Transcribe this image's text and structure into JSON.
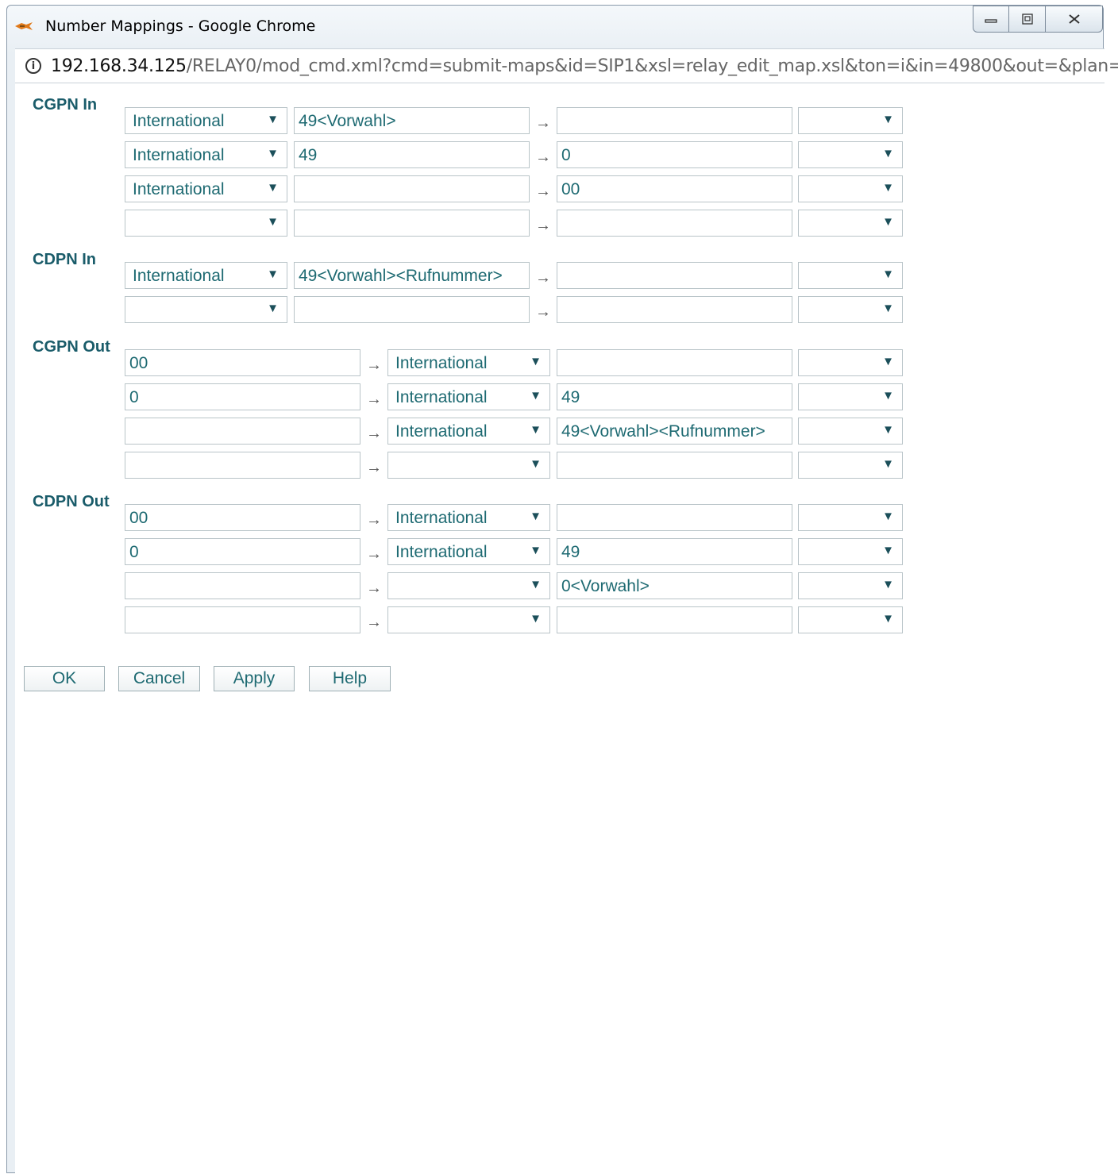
{
  "window": {
    "title": "Number Mappings - Google Chrome"
  },
  "address": {
    "host": "192.168.34.125",
    "path": "/RELAY0/mod_cmd.xml?cmd=submit-maps&id=SIP1&xsl=relay_edit_map.xsl&ton=i&in=49800&out=&plan="
  },
  "sections": {
    "cgpn_in": {
      "label": "CGPN In",
      "rows": [
        {
          "type": "International",
          "in": "49<Vorwahl>",
          "out": "",
          "plan": ""
        },
        {
          "type": "International",
          "in": "49",
          "out": "0",
          "plan": ""
        },
        {
          "type": "International",
          "in": "",
          "out": "00",
          "plan": ""
        },
        {
          "type": "",
          "in": "",
          "out": "",
          "plan": ""
        }
      ]
    },
    "cdpn_in": {
      "label": "CDPN In",
      "rows": [
        {
          "type": "International",
          "in": "49<Vorwahl><Rufnummer>",
          "out": "",
          "plan": ""
        },
        {
          "type": "",
          "in": "",
          "out": "",
          "plan": ""
        }
      ]
    },
    "cgpn_out": {
      "label": "CGPN Out",
      "rows": [
        {
          "in": "00",
          "type": "International",
          "out": "",
          "plan": ""
        },
        {
          "in": "0",
          "type": "International",
          "out": "49",
          "plan": ""
        },
        {
          "in": "",
          "type": "International",
          "out": "49<Vorwahl><Rufnummer>",
          "plan": ""
        },
        {
          "in": "",
          "type": "",
          "out": "",
          "plan": ""
        }
      ]
    },
    "cdpn_out": {
      "label": "CDPN Out",
      "rows": [
        {
          "in": "00",
          "type": "International",
          "out": "",
          "plan": ""
        },
        {
          "in": "0",
          "type": "International",
          "out": "49",
          "plan": ""
        },
        {
          "in": "",
          "type": "",
          "out": "0<Vorwahl>",
          "plan": ""
        },
        {
          "in": "",
          "type": "",
          "out": "",
          "plan": ""
        }
      ]
    }
  },
  "buttons": {
    "ok": "OK",
    "cancel": "Cancel",
    "apply": "Apply",
    "help": "Help"
  },
  "symbols": {
    "arrow": "→",
    "dropdown": "▼"
  },
  "colors": {
    "label": "#1a5c6a",
    "field_text": "#1e6a72"
  }
}
